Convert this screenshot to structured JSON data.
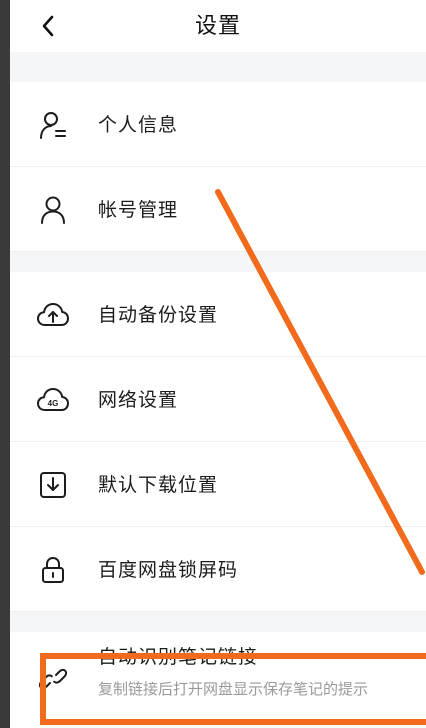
{
  "header": {
    "title": "设置"
  },
  "settings": {
    "items": [
      {
        "label": "个人信息",
        "icon": "user-card-icon"
      },
      {
        "label": "帐号管理",
        "icon": "user-icon"
      },
      {
        "label": "自动备份设置",
        "icon": "cloud-upload-icon"
      },
      {
        "label": "网络设置",
        "icon": "cloud-4g-icon"
      },
      {
        "label": "默认下载位置",
        "icon": "download-box-icon"
      },
      {
        "label": "百度网盘锁屏码",
        "icon": "lock-icon"
      },
      {
        "label": "自动识别笔记链接",
        "sublabel": "复制链接后打开网盘显示保存笔记的提示",
        "icon": "link-icon"
      }
    ]
  },
  "icons": {
    "cloud_badge": "4G"
  },
  "annotation": {
    "color": "#f26b1d"
  }
}
